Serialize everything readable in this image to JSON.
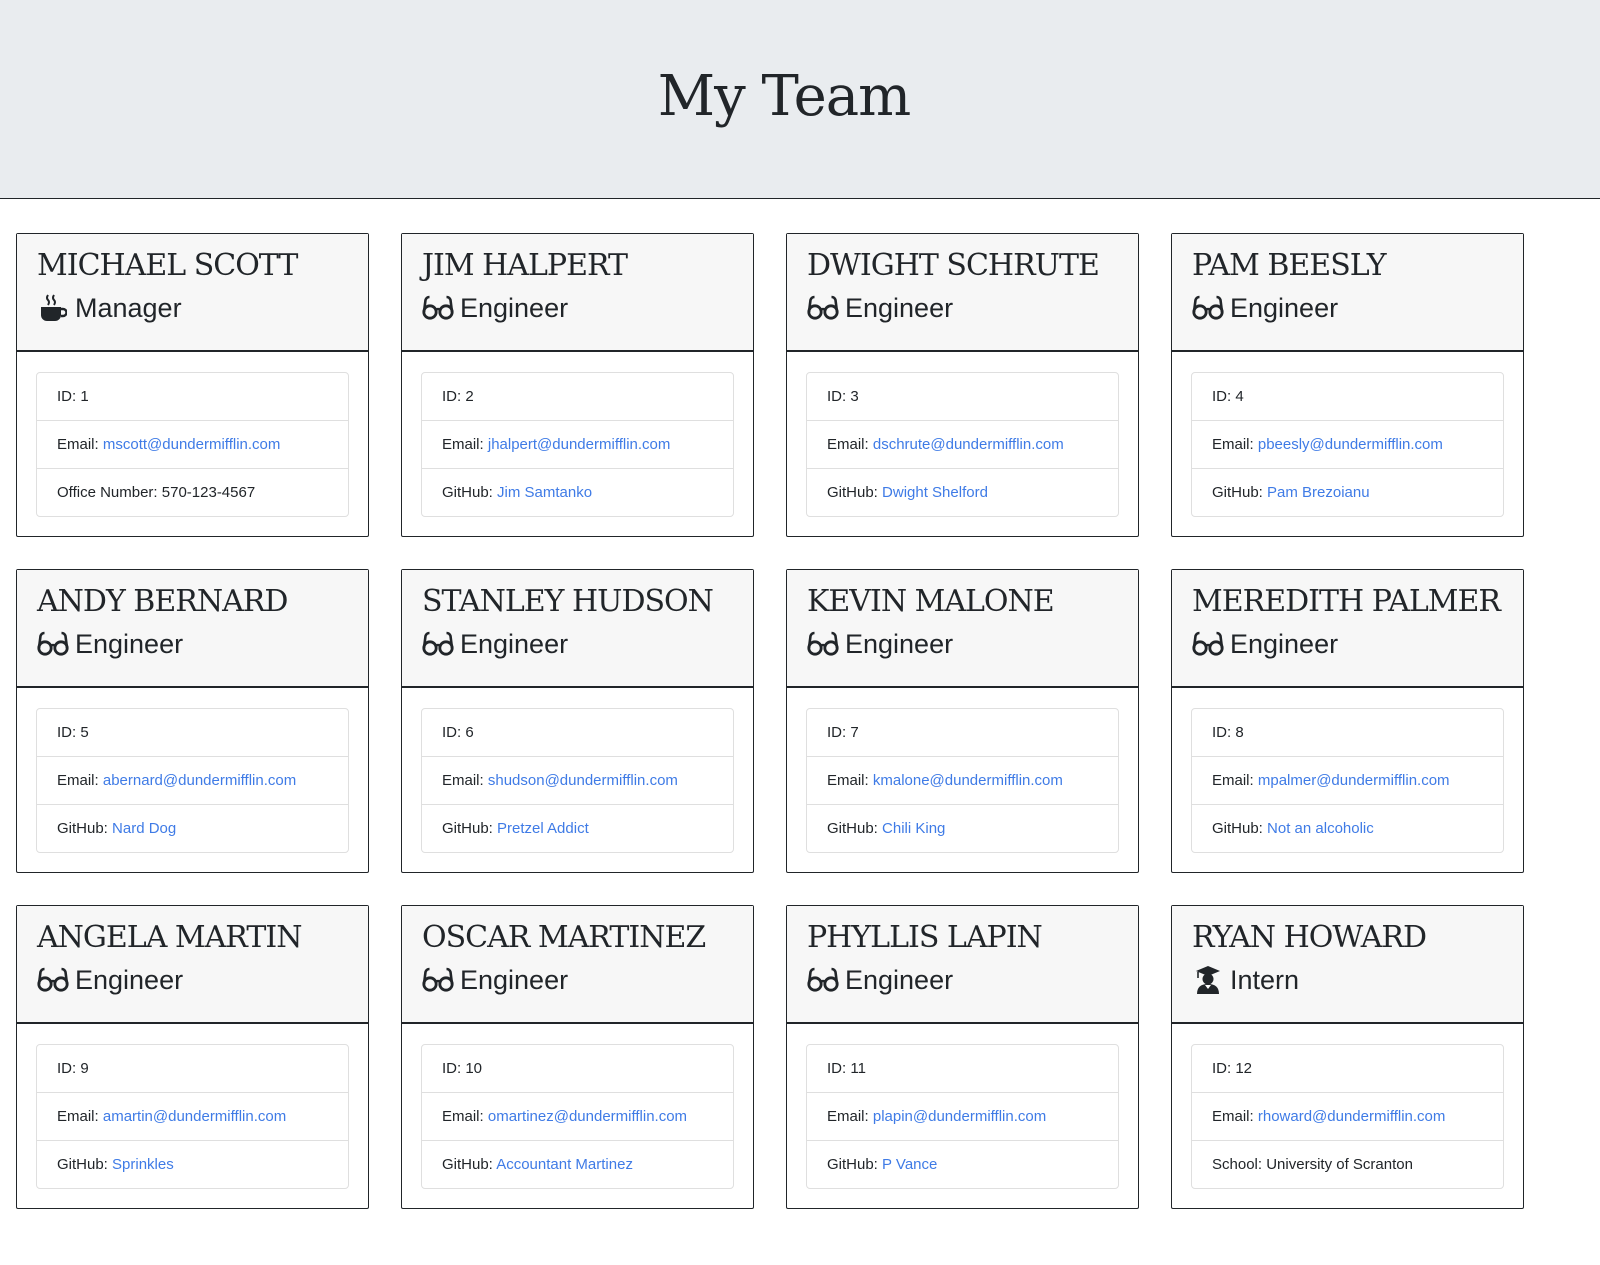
{
  "page_title": "My Team",
  "team": [
    {
      "name": "MICHAEL SCOTT",
      "role": "Manager",
      "icon": "coffee-icon",
      "id_label": "ID:",
      "id": "1",
      "email_label": "Email:",
      "email": "mscott@dundermifflin.com",
      "extra_label": "Office Number:",
      "extra": "570-123-4567",
      "extra_is_link": false
    },
    {
      "name": "JIM HALPERT",
      "role": "Engineer",
      "icon": "glasses-icon",
      "id_label": "ID:",
      "id": "2",
      "email_label": "Email:",
      "email": "jhalpert@dundermifflin.com",
      "extra_label": "GitHub:",
      "extra": "Jim Samtanko",
      "extra_is_link": true
    },
    {
      "name": "DWIGHT SCHRUTE",
      "role": "Engineer",
      "icon": "glasses-icon",
      "id_label": "ID:",
      "id": "3",
      "email_label": "Email:",
      "email": "dschrute@dundermifflin.com",
      "extra_label": "GitHub:",
      "extra": "Dwight Shelford",
      "extra_is_link": true
    },
    {
      "name": "PAM BEESLY",
      "role": "Engineer",
      "icon": "glasses-icon",
      "id_label": "ID:",
      "id": "4",
      "email_label": "Email:",
      "email": "pbeesly@dundermifflin.com",
      "extra_label": "GitHub:",
      "extra": "Pam Brezoianu",
      "extra_is_link": true
    },
    {
      "name": "ANDY BERNARD",
      "role": "Engineer",
      "icon": "glasses-icon",
      "id_label": "ID:",
      "id": "5",
      "email_label": "Email:",
      "email": "abernard@dundermifflin.com",
      "extra_label": "GitHub:",
      "extra": "Nard Dog",
      "extra_is_link": true
    },
    {
      "name": "STANLEY HUDSON",
      "role": "Engineer",
      "icon": "glasses-icon",
      "id_label": "ID:",
      "id": "6",
      "email_label": "Email:",
      "email": "shudson@dundermifflin.com",
      "extra_label": "GitHub:",
      "extra": "Pretzel Addict",
      "extra_is_link": true
    },
    {
      "name": "KEVIN MALONE",
      "role": "Engineer",
      "icon": "glasses-icon",
      "id_label": "ID:",
      "id": "7",
      "email_label": "Email:",
      "email": "kmalone@dundermifflin.com",
      "extra_label": "GitHub:",
      "extra": "Chili King",
      "extra_is_link": true
    },
    {
      "name": "MEREDITH PALMER",
      "role": "Engineer",
      "icon": "glasses-icon",
      "id_label": "ID:",
      "id": "8",
      "email_label": "Email:",
      "email": "mpalmer@dundermifflin.com",
      "extra_label": "GitHub:",
      "extra": "Not an alcoholic",
      "extra_is_link": true
    },
    {
      "name": "ANGELA MARTIN",
      "role": "Engineer",
      "icon": "glasses-icon",
      "id_label": "ID:",
      "id": "9",
      "email_label": "Email:",
      "email": "amartin@dundermifflin.com",
      "extra_label": "GitHub:",
      "extra": "Sprinkles",
      "extra_is_link": true
    },
    {
      "name": "OSCAR MARTINEZ",
      "role": "Engineer",
      "icon": "glasses-icon",
      "id_label": "ID:",
      "id": "10",
      "email_label": "Email:",
      "email": "omartinez@dundermifflin.com",
      "extra_label": "GitHub:",
      "extra": "Accountant Martinez",
      "extra_is_link": true
    },
    {
      "name": "PHYLLIS LAPIN",
      "role": "Engineer",
      "icon": "glasses-icon",
      "id_label": "ID:",
      "id": "11",
      "email_label": "Email:",
      "email": "plapin@dundermifflin.com",
      "extra_label": "GitHub:",
      "extra": "P Vance",
      "extra_is_link": true
    },
    {
      "name": "RYAN HOWARD",
      "role": "Intern",
      "icon": "graduate-icon",
      "id_label": "ID:",
      "id": "12",
      "email_label": "Email:",
      "email": "rhoward@dundermifflin.com",
      "extra_label": "School:",
      "extra": "University of Scranton",
      "extra_is_link": false
    }
  ],
  "colors": {
    "header_bg": "#e9ecef",
    "card_header_bg": "#f7f7f7",
    "link": "#3f7be6",
    "text": "#212529"
  }
}
